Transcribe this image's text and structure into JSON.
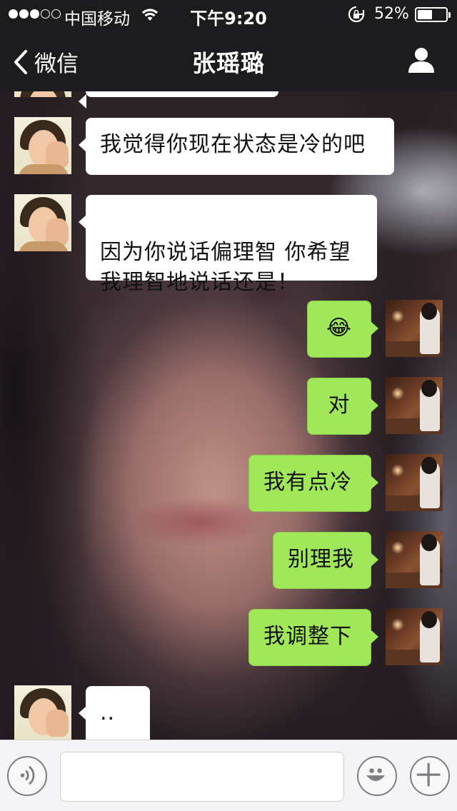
{
  "status_bar": {
    "signal_filled": 3,
    "signal_total": 5,
    "carrier": "中国移动",
    "time": "下午9:20",
    "battery_percent_label": "52%",
    "battery_level": 0.52
  },
  "nav": {
    "back_label": "微信",
    "title": "张瑶璐",
    "profile_icon": "person-icon"
  },
  "messages": [
    {
      "sender": "contact",
      "text": ""
    },
    {
      "sender": "contact",
      "text": "我觉得你现在状态是冷的吧"
    },
    {
      "sender": "contact",
      "text": "因为你说话偏理智 你希望\n我理智地说话还是！"
    },
    {
      "sender": "me",
      "text": "😂"
    },
    {
      "sender": "me",
      "text": "对"
    },
    {
      "sender": "me",
      "text": "我有点冷"
    },
    {
      "sender": "me",
      "text": "别理我"
    },
    {
      "sender": "me",
      "text": "我调整下"
    },
    {
      "sender": "contact",
      "text": ".."
    }
  ],
  "input_bar": {
    "voice_icon": "voice-icon",
    "input_value": "",
    "emoji_icon": "emoji-icon",
    "add_icon": "plus-icon"
  },
  "colors": {
    "outgoing_bubble": "#a0e75a",
    "incoming_bubble": "#ffffff",
    "top_bar": "#1c1c1e"
  }
}
